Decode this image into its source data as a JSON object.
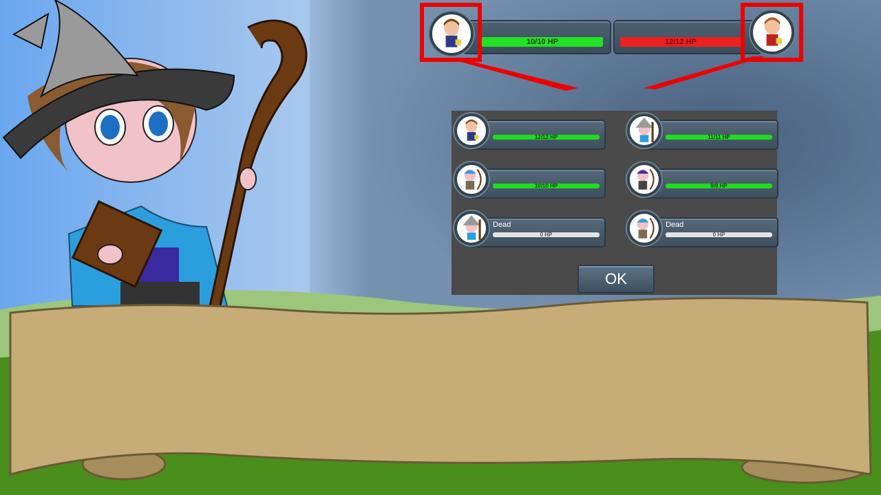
{
  "colors": {
    "ally_hp": "#22e322",
    "enemy_hp": "#ee1f1f",
    "highlight": "#ee0000",
    "panel": "#4a4a4a"
  },
  "hud": {
    "player_hp": "10/10 HP",
    "enemy_hp": "12/12 HP"
  },
  "party": [
    {
      "portrait": "brown-hair-warrior-icon",
      "status": "",
      "hp": "12/12 HP",
      "state": "alive"
    },
    {
      "portrait": "gray-wizard-icon",
      "status": "",
      "hp": "11/11 HP",
      "state": "alive"
    },
    {
      "portrait": "blue-archer-icon",
      "status": "",
      "hp": "10/10 HP",
      "state": "alive"
    },
    {
      "portrait": "purple-archer-icon",
      "status": "",
      "hp": "9/9 HP",
      "state": "alive"
    },
    {
      "portrait": "gray-wizard-icon",
      "status": "Dead",
      "hp": "0 HP",
      "state": "dead"
    },
    {
      "portrait": "blue-archer-icon",
      "status": "Dead",
      "hp": "0 HP",
      "state": "dead"
    }
  ],
  "ok_label": "OK"
}
